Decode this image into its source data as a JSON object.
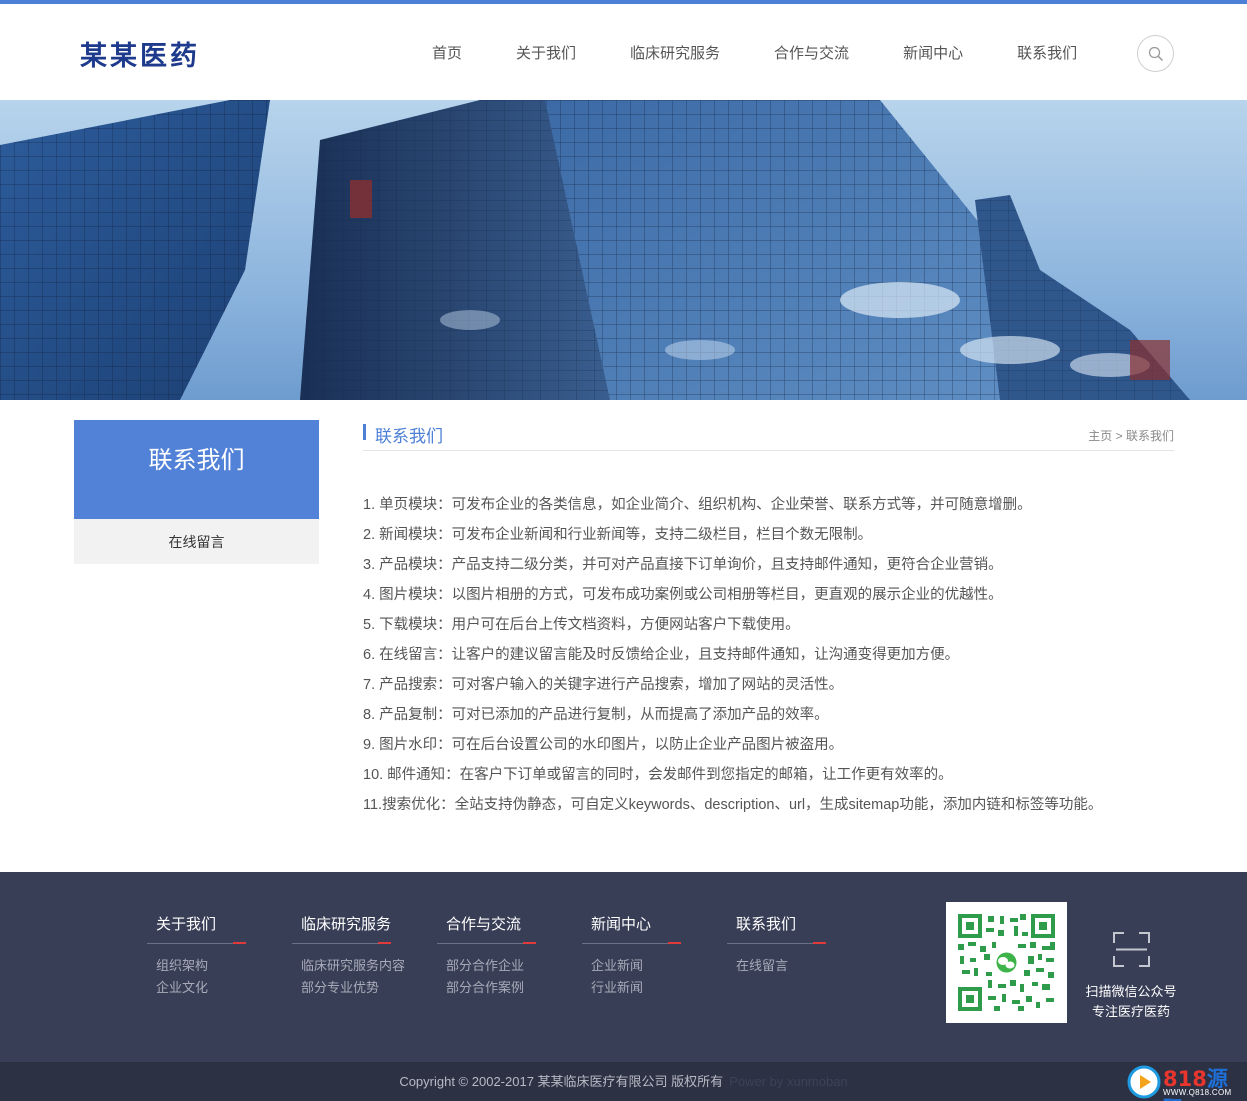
{
  "brand": {
    "name": "某某医药"
  },
  "nav": {
    "items": [
      "首页",
      "关于我们",
      "临床研究服务",
      "合作与交流",
      "新闻中心",
      "联系我们"
    ],
    "search_icon": "search-icon"
  },
  "sidebar": {
    "title": "联系我们",
    "items": [
      "在线留言"
    ]
  },
  "main": {
    "title": "联系我们",
    "breadcrumb": {
      "home": "主页",
      "sep": ">",
      "current": "联系我们"
    },
    "paragraphs": [
      " 1. 单页模块：可发布企业的各类信息，如企业简介、组织机构、企业荣誉、联系方式等，并可随意增删。",
      "2. 新闻模块：可发布企业新闻和行业新闻等，支持二级栏目，栏目个数无限制。",
      "3. 产品模块：产品支持二级分类，并可对产品直接下订单询价，且支持邮件通知，更符合企业营销。",
      "4. 图片模块：以图片相册的方式，可发布成功案例或公司相册等栏目，更直观的展示企业的优越性。",
      "5. 下载模块：用户可在后台上传文档资料，方便网站客户下载使用。",
      "6. 在线留言：让客户的建议留言能及时反馈给企业，且支持邮件通知，让沟通变得更加方便。",
      "7. 产品搜索：可对客户输入的关键字进行产品搜索，增加了网站的灵活性。",
      "8. 产品复制：可对已添加的产品进行复制，从而提高了添加产品的效率。",
      "9. 图片水印：可在后台设置公司的水印图片，以防止企业产品图片被盗用。",
      "10. 邮件通知：在客户下订单或留言的同时，会发邮件到您指定的邮箱，让工作更有效率的。",
      "11.搜索优化：全站支持伪静态，可自定义keywords、description、url，生成sitemap功能，添加内链和标签等功能。"
    ]
  },
  "footer": {
    "columns": [
      {
        "title": "关于我们",
        "links": [
          "组织架构",
          "企业文化"
        ]
      },
      {
        "title": "临床研究服务",
        "links": [
          "临床研究服务内容",
          "部分专业优势"
        ]
      },
      {
        "title": "合作与交流",
        "links": [
          "部分合作企业",
          "部分合作案例"
        ]
      },
      {
        "title": "新闻中心",
        "links": [
          "企业新闻",
          "行业新闻"
        ]
      },
      {
        "title": "联系我们",
        "links": [
          "在线留言"
        ]
      }
    ],
    "qr_text_line1": "扫描微信公众号",
    "qr_text_line2": "专注医疗医药",
    "copyright": "Copyright © 2002-2017 某某临床医疗有限公司 版权所有",
    "powered": "Power by xunmoban"
  },
  "watermark": {
    "brand_num": "818",
    "brand_cn": "源码",
    "url": "WWW.Q818.COM"
  },
  "colors": {
    "accent": "#4c7fd6",
    "sidebar_title_bg": "#5282d8",
    "footer_bg": "#383e56",
    "footer_bottom_bg": "#2c3144",
    "underline_red": "#e23a3a"
  }
}
